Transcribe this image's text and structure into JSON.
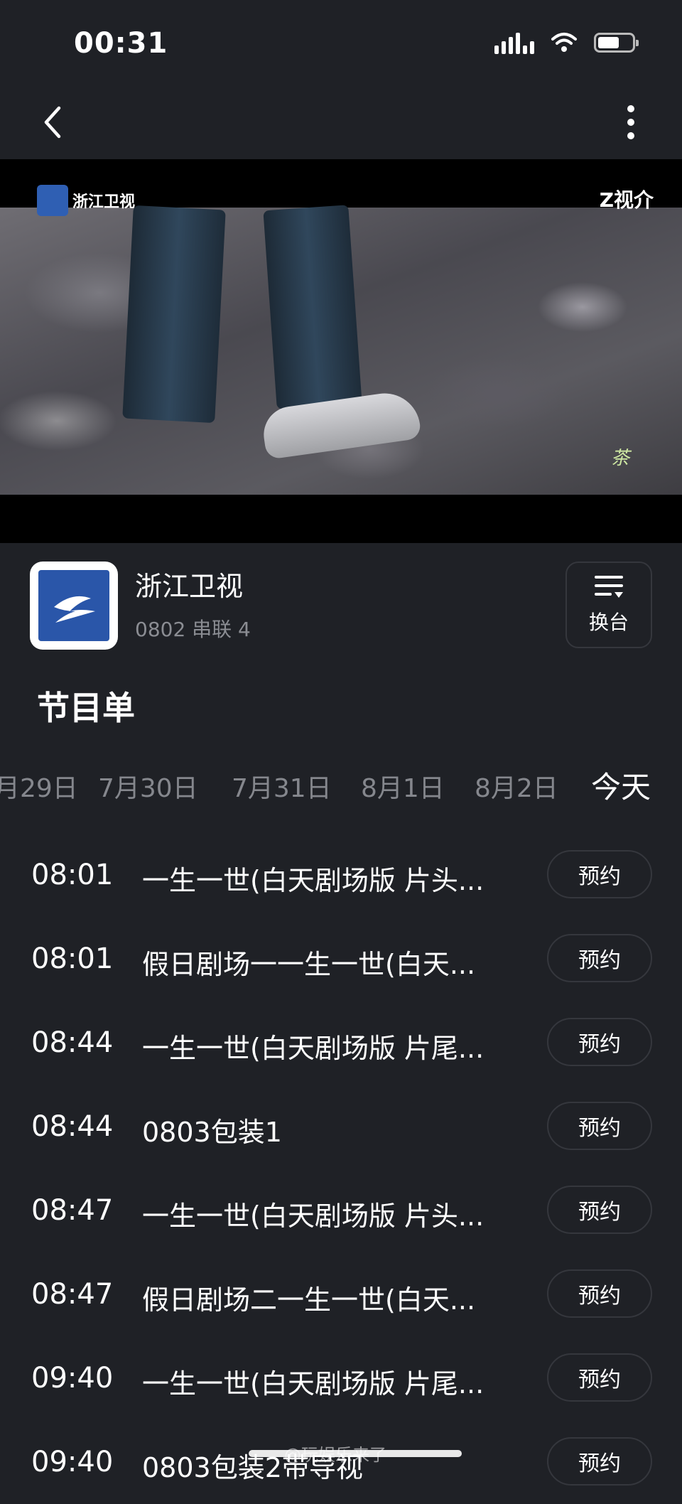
{
  "status_bar": {
    "time": "00:31"
  },
  "video": {
    "channel_logo_text": "浙江卫视",
    "platform_mark": "Z视介"
  },
  "channel": {
    "name": "浙江卫视",
    "current_program": "0802 串联 4",
    "switch_label": "换台"
  },
  "section_title": "节目单",
  "date_tabs": [
    "月29日",
    "7月30日",
    "7月31日",
    "8月1日",
    "8月2日",
    "今天"
  ],
  "schedule": [
    {
      "time": "08:01",
      "title": "一生一世(白天剧场版 片头...",
      "button": "预约"
    },
    {
      "time": "08:01",
      "title": "假日剧场一一生一世(白天...",
      "button": "预约"
    },
    {
      "time": "08:44",
      "title": "一生一世(白天剧场版 片尾...",
      "button": "预约"
    },
    {
      "time": "08:44",
      "title": "0803包装1",
      "button": "预约"
    },
    {
      "time": "08:47",
      "title": "一生一世(白天剧场版 片头...",
      "button": "预约"
    },
    {
      "time": "08:47",
      "title": "假日剧场二一生一世(白天...",
      "button": "预约"
    },
    {
      "time": "09:40",
      "title": "一生一世(白天剧场版 片尾...",
      "button": "预约"
    },
    {
      "time": "09:40",
      "title": "0803包装2带导视",
      "button": "预约"
    }
  ],
  "watermark": "@玩娱乐来了"
}
